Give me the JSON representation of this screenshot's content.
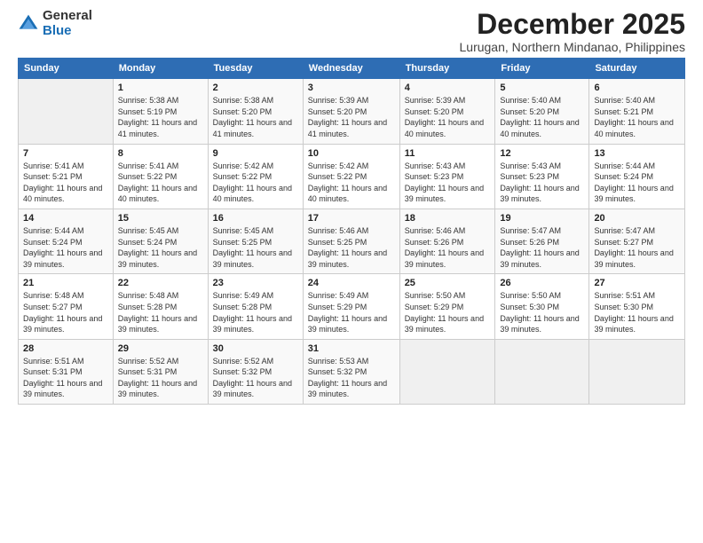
{
  "logo": {
    "general": "General",
    "blue": "Blue"
  },
  "title": "December 2025",
  "location": "Lurugan, Northern Mindanao, Philippines",
  "days_of_week": [
    "Sunday",
    "Monday",
    "Tuesday",
    "Wednesday",
    "Thursday",
    "Friday",
    "Saturday"
  ],
  "weeks": [
    [
      {
        "day": "",
        "info": ""
      },
      {
        "day": "1",
        "info": "Sunrise: 5:38 AM\nSunset: 5:19 PM\nDaylight: 11 hours and 41 minutes."
      },
      {
        "day": "2",
        "info": "Sunrise: 5:38 AM\nSunset: 5:20 PM\nDaylight: 11 hours and 41 minutes."
      },
      {
        "day": "3",
        "info": "Sunrise: 5:39 AM\nSunset: 5:20 PM\nDaylight: 11 hours and 41 minutes."
      },
      {
        "day": "4",
        "info": "Sunrise: 5:39 AM\nSunset: 5:20 PM\nDaylight: 11 hours and 40 minutes."
      },
      {
        "day": "5",
        "info": "Sunrise: 5:40 AM\nSunset: 5:20 PM\nDaylight: 11 hours and 40 minutes."
      },
      {
        "day": "6",
        "info": "Sunrise: 5:40 AM\nSunset: 5:21 PM\nDaylight: 11 hours and 40 minutes."
      }
    ],
    [
      {
        "day": "7",
        "info": "Sunrise: 5:41 AM\nSunset: 5:21 PM\nDaylight: 11 hours and 40 minutes."
      },
      {
        "day": "8",
        "info": "Sunrise: 5:41 AM\nSunset: 5:22 PM\nDaylight: 11 hours and 40 minutes."
      },
      {
        "day": "9",
        "info": "Sunrise: 5:42 AM\nSunset: 5:22 PM\nDaylight: 11 hours and 40 minutes."
      },
      {
        "day": "10",
        "info": "Sunrise: 5:42 AM\nSunset: 5:22 PM\nDaylight: 11 hours and 40 minutes."
      },
      {
        "day": "11",
        "info": "Sunrise: 5:43 AM\nSunset: 5:23 PM\nDaylight: 11 hours and 39 minutes."
      },
      {
        "day": "12",
        "info": "Sunrise: 5:43 AM\nSunset: 5:23 PM\nDaylight: 11 hours and 39 minutes."
      },
      {
        "day": "13",
        "info": "Sunrise: 5:44 AM\nSunset: 5:24 PM\nDaylight: 11 hours and 39 minutes."
      }
    ],
    [
      {
        "day": "14",
        "info": "Sunrise: 5:44 AM\nSunset: 5:24 PM\nDaylight: 11 hours and 39 minutes."
      },
      {
        "day": "15",
        "info": "Sunrise: 5:45 AM\nSunset: 5:24 PM\nDaylight: 11 hours and 39 minutes."
      },
      {
        "day": "16",
        "info": "Sunrise: 5:45 AM\nSunset: 5:25 PM\nDaylight: 11 hours and 39 minutes."
      },
      {
        "day": "17",
        "info": "Sunrise: 5:46 AM\nSunset: 5:25 PM\nDaylight: 11 hours and 39 minutes."
      },
      {
        "day": "18",
        "info": "Sunrise: 5:46 AM\nSunset: 5:26 PM\nDaylight: 11 hours and 39 minutes."
      },
      {
        "day": "19",
        "info": "Sunrise: 5:47 AM\nSunset: 5:26 PM\nDaylight: 11 hours and 39 minutes."
      },
      {
        "day": "20",
        "info": "Sunrise: 5:47 AM\nSunset: 5:27 PM\nDaylight: 11 hours and 39 minutes."
      }
    ],
    [
      {
        "day": "21",
        "info": "Sunrise: 5:48 AM\nSunset: 5:27 PM\nDaylight: 11 hours and 39 minutes."
      },
      {
        "day": "22",
        "info": "Sunrise: 5:48 AM\nSunset: 5:28 PM\nDaylight: 11 hours and 39 minutes."
      },
      {
        "day": "23",
        "info": "Sunrise: 5:49 AM\nSunset: 5:28 PM\nDaylight: 11 hours and 39 minutes."
      },
      {
        "day": "24",
        "info": "Sunrise: 5:49 AM\nSunset: 5:29 PM\nDaylight: 11 hours and 39 minutes."
      },
      {
        "day": "25",
        "info": "Sunrise: 5:50 AM\nSunset: 5:29 PM\nDaylight: 11 hours and 39 minutes."
      },
      {
        "day": "26",
        "info": "Sunrise: 5:50 AM\nSunset: 5:30 PM\nDaylight: 11 hours and 39 minutes."
      },
      {
        "day": "27",
        "info": "Sunrise: 5:51 AM\nSunset: 5:30 PM\nDaylight: 11 hours and 39 minutes."
      }
    ],
    [
      {
        "day": "28",
        "info": "Sunrise: 5:51 AM\nSunset: 5:31 PM\nDaylight: 11 hours and 39 minutes."
      },
      {
        "day": "29",
        "info": "Sunrise: 5:52 AM\nSunset: 5:31 PM\nDaylight: 11 hours and 39 minutes."
      },
      {
        "day": "30",
        "info": "Sunrise: 5:52 AM\nSunset: 5:32 PM\nDaylight: 11 hours and 39 minutes."
      },
      {
        "day": "31",
        "info": "Sunrise: 5:53 AM\nSunset: 5:32 PM\nDaylight: 11 hours and 39 minutes."
      },
      {
        "day": "",
        "info": ""
      },
      {
        "day": "",
        "info": ""
      },
      {
        "day": "",
        "info": ""
      }
    ]
  ]
}
